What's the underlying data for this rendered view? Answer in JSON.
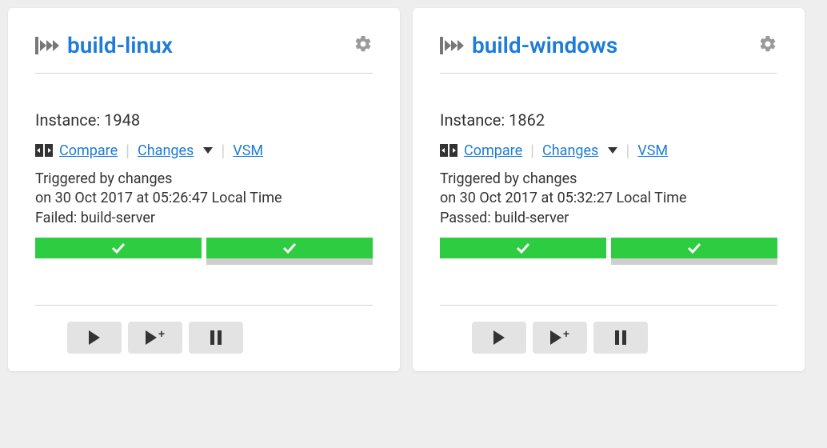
{
  "pipelines": [
    {
      "name": "build-linux",
      "instance_label": "Instance:",
      "instance_number": "1948",
      "compare_label": "Compare",
      "changes_label": "Changes",
      "vsm_label": "VSM",
      "triggered_line": "Triggered by changes",
      "time_line": "on 30 Oct 2017 at 05:26:47 Local Time",
      "status_line": "Failed: build-server",
      "stages": [
        {
          "status": "passed",
          "running": false
        },
        {
          "status": "passed",
          "running": true
        }
      ]
    },
    {
      "name": "build-windows",
      "instance_label": "Instance:",
      "instance_number": "1862",
      "compare_label": "Compare",
      "changes_label": "Changes",
      "vsm_label": "VSM",
      "triggered_line": "Triggered by changes",
      "time_line": "on 30 Oct 2017 at 05:32:27 Local Time",
      "status_line": "Passed: build-server",
      "stages": [
        {
          "status": "passed",
          "running": false
        },
        {
          "status": "passed",
          "running": true
        }
      ]
    }
  ],
  "colors": {
    "link": "#1c7cd6",
    "passed": "#2ecc40",
    "button_bg": "#e3e3e3"
  }
}
